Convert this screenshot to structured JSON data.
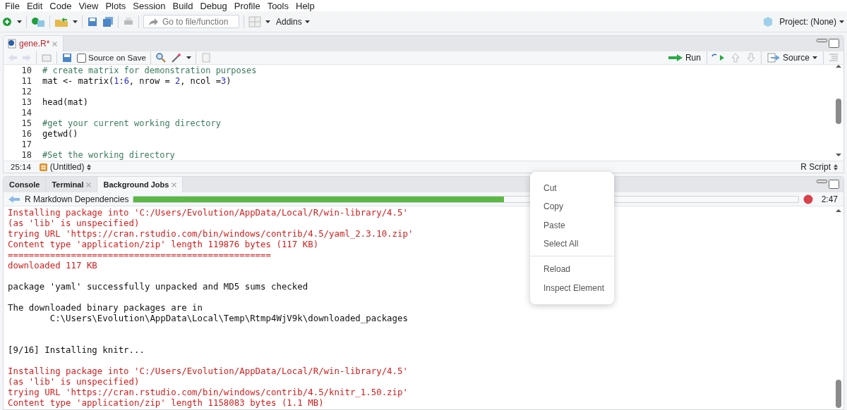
{
  "menu": [
    "File",
    "Edit",
    "Code",
    "View",
    "Plots",
    "Session",
    "Build",
    "Debug",
    "Profile",
    "Tools",
    "Help"
  ],
  "toolbar": {
    "search": {
      "placeholder": "Go to file/function"
    },
    "addins": "Addins",
    "project": "Project: (None)"
  },
  "source_pane": {
    "tab": {
      "label": "gene.R*",
      "modified": true
    },
    "toolbar": {
      "source_on_save": {
        "label": "Source on Save",
        "checked": false
      },
      "run": "Run",
      "source": "Source"
    },
    "lines": [
      {
        "number": "10",
        "segments": [
          {
            "kind": "comment",
            "text": "# create matrix for demonstration purposes"
          }
        ]
      },
      {
        "number": "11",
        "segments": [
          {
            "kind": "code",
            "text": "mat <- matrix("
          },
          {
            "kind": "number",
            "text": "1"
          },
          {
            "kind": "code",
            "text": ":"
          },
          {
            "kind": "number",
            "text": "6"
          },
          {
            "kind": "code",
            "text": ", nrow = "
          },
          {
            "kind": "number",
            "text": "2"
          },
          {
            "kind": "code",
            "text": ", ncol ="
          },
          {
            "kind": "number",
            "text": "3"
          },
          {
            "kind": "code",
            "text": ")"
          }
        ]
      },
      {
        "number": "12"
      },
      {
        "number": "13",
        "segments": [
          {
            "kind": "code",
            "text": "head(mat)"
          }
        ]
      },
      {
        "number": "14"
      },
      {
        "number": "15",
        "segments": [
          {
            "kind": "comment",
            "text": "#get your current working directory"
          }
        ]
      },
      {
        "number": "16",
        "segments": [
          {
            "kind": "code",
            "text": "getwd()"
          }
        ]
      },
      {
        "number": "17"
      },
      {
        "number": "18",
        "segments": [
          {
            "kind": "comment",
            "text": "#Set the working directory"
          }
        ]
      }
    ],
    "status": {
      "position": "25:14",
      "scope": "(Untitled)",
      "file_type": "R Script"
    }
  },
  "console_pane": {
    "tabs": [
      {
        "label": "Console",
        "closable": false,
        "selected": false
      },
      {
        "label": "Terminal",
        "closable": true,
        "selected": false
      },
      {
        "label": "Background Jobs",
        "closable": true,
        "selected": true
      }
    ],
    "job": {
      "name": "R Markdown Dependencies",
      "level": 0.557,
      "elapsed": "2:47"
    },
    "output": [
      {
        "kind": "error",
        "text": "Installing package into 'C:/Users/Evolution/AppData/Local/R/win-library/4.5'"
      },
      {
        "kind": "error",
        "text": "(as 'lib' is unspecified)"
      },
      {
        "kind": "error",
        "text": "trying URL 'https://cran.rstudio.com/bin/windows/contrib/4.5/yaml_2.3.10.zip'"
      },
      {
        "kind": "error",
        "text": "Content type 'application/zip' length 119876 bytes (117 KB)"
      },
      {
        "kind": "error",
        "text": "=================================================="
      },
      {
        "kind": "error",
        "text": "downloaded 117 KB"
      },
      {
        "kind": "blank"
      },
      {
        "kind": "output",
        "text": "package 'yaml' successfully unpacked and MD5 sums checked"
      },
      {
        "kind": "blank"
      },
      {
        "kind": "output",
        "text": "The downloaded binary packages are in"
      },
      {
        "kind": "output",
        "text": "        C:\\Users\\Evolution\\AppData\\Local\\Temp\\Rtmp4WjV9k\\downloaded_packages"
      },
      {
        "kind": "blank"
      },
      {
        "kind": "blank"
      },
      {
        "kind": "output",
        "text": "[9/16] Installing knitr..."
      },
      {
        "kind": "blank"
      },
      {
        "kind": "error",
        "text": "Installing package into 'C:/Users/Evolution/AppData/Local/R/win-library/4.5'"
      },
      {
        "kind": "error",
        "text": "(as 'lib' is unspecified)"
      },
      {
        "kind": "error",
        "text": "trying URL 'https://cran.rstudio.com/bin/windows/contrib/4.5/knitr_1.50.zip'"
      },
      {
        "kind": "error",
        "text": "Content type 'application/zip' length 1158083 bytes (1.1 MB)"
      }
    ]
  },
  "context_menu": [
    {
      "kind": "item",
      "label": "Cut"
    },
    {
      "kind": "item",
      "label": "Copy"
    },
    {
      "kind": "item",
      "label": "Paste"
    },
    {
      "kind": "item",
      "label": "Select All"
    },
    {
      "kind": "separator"
    },
    {
      "kind": "item",
      "label": "Reload"
    },
    {
      "kind": "item",
      "label": "Inspect Element"
    }
  ]
}
